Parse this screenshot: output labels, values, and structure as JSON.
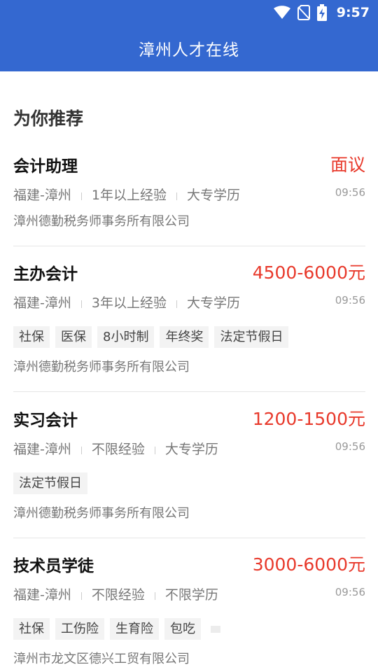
{
  "status_bar": {
    "time": "9:57"
  },
  "app_bar": {
    "title": "漳州人才在线"
  },
  "section": {
    "title": "为你推荐"
  },
  "jobs": [
    {
      "title": "会计助理",
      "salary": "面议",
      "location": "福建-漳州",
      "experience": "1年以上经验",
      "education": "大专学历",
      "time": "09:56",
      "tags": [],
      "company": "漳州德勤税务师事务所有限公司"
    },
    {
      "title": "主办会计",
      "salary": "4500-6000元",
      "location": "福建-漳州",
      "experience": "3年以上经验",
      "education": "大专学历",
      "time": "09:56",
      "tags": [
        "社保",
        "医保",
        "8小时制",
        "年终奖",
        "法定节假日"
      ],
      "company": "漳州德勤税务师事务所有限公司"
    },
    {
      "title": "实习会计",
      "salary": "1200-1500元",
      "location": "福建-漳州",
      "experience": "不限经验",
      "education": "大专学历",
      "time": "09:56",
      "tags": [
        "法定节假日"
      ],
      "company": "漳州德勤税务师事务所有限公司"
    },
    {
      "title": "技术员学徒",
      "salary": "3000-6000元",
      "location": "福建-漳州",
      "experience": "不限经验",
      "education": "不限学历",
      "time": "09:56",
      "tags": [
        "社保",
        "工伤险",
        "生育险",
        "包吃"
      ],
      "company": "漳州市龙文区德兴工贸有限公司"
    }
  ],
  "colors": {
    "primary": "#3468d0",
    "salary": "#e8392b",
    "tag_bg": "#f3f3f3"
  },
  "icons": [
    "wifi-icon",
    "no-sim-icon",
    "battery-charging-icon"
  ]
}
